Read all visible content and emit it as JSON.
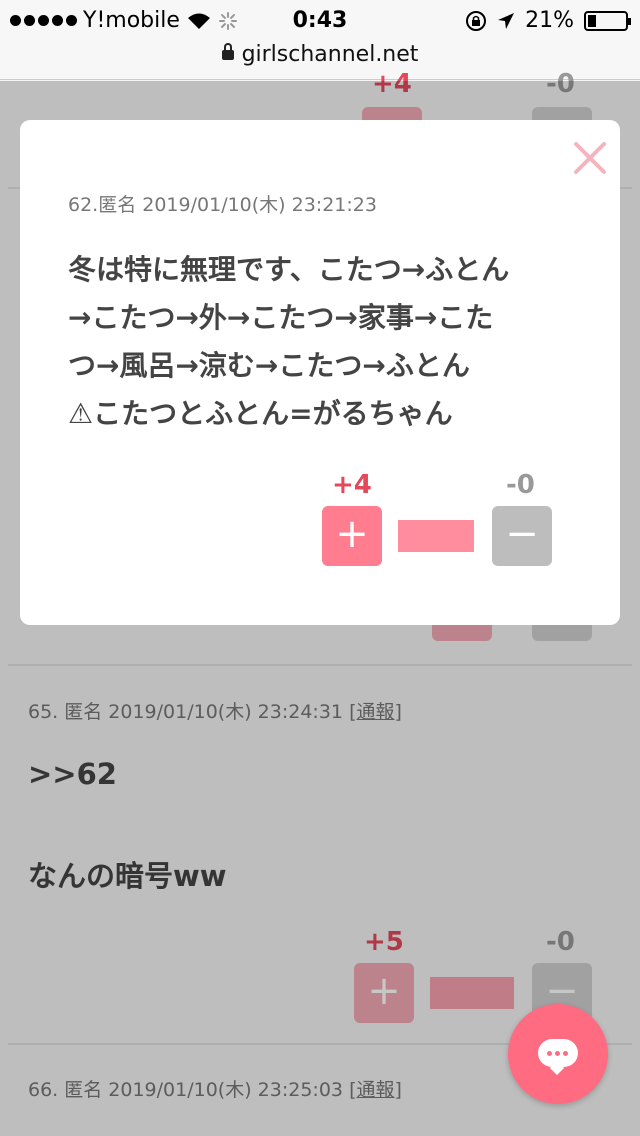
{
  "status_bar": {
    "carrier": "Y!mobile",
    "time": "0:43",
    "battery": "21%"
  },
  "url_bar": {
    "domain": "girlschannel.net"
  },
  "background": {
    "top_post": {
      "plus": "+4",
      "minus": "-0"
    },
    "comment_65": {
      "meta": "65. 匿名 2019/01/10(木) 23:24:31",
      "report": "[通報]",
      "quote": ">>62",
      "text": "なんの暗号ww",
      "plus": "+5",
      "minus": "-0"
    },
    "comment_66": {
      "meta": "66. 匿名 2019/01/10(木) 23:25:03",
      "report": "[通報]"
    }
  },
  "modal": {
    "meta": "62.匿名 2019/01/10(木) 23:21:23",
    "lines": [
      "冬は特に無理です、こたつ→ふとん",
      "→こたつ→外→こたつ→家事→こた",
      "つ→風呂→涼む→こたつ→ふとん",
      "⚠こたつとふとん=がるちゃん"
    ],
    "plus": "+4",
    "minus": "-0",
    "plus_symbol": "+",
    "minus_symbol": "−"
  },
  "colors": {
    "accent": "#ff6b81",
    "plus_red": "#e3495b",
    "minus_gray": "#999999"
  }
}
